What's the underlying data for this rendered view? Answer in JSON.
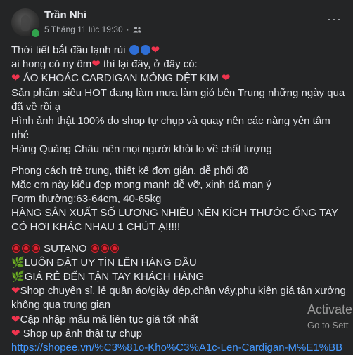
{
  "post": {
    "author": "Trần Nhi",
    "timestamp": "5 Tháng 11 lúc 19:30",
    "separator": "·",
    "more_label": "···",
    "lines": [
      "Thời tiết bắt đầu lạnh rùi",
      "ai hong có ny ôm",
      "thì lại đây, ở đây có:",
      "ÁO KHOÁC CARDIGAN MỎNG DỆT KIM",
      "Sản phẩm siêu HOT đang làm mưa làm gió bên Trung những ngày qua đã về rồi ạ",
      "Hình ảnh thật 100% do shop tự chụp và quay nên các nàng yên tâm nhé",
      "Hàng Quảng Châu nên mọi người khỏi lo về chất lượng",
      "Phong cách trẻ trung, thiết kế đơn giản, dễ phối đồ",
      "Mặc em này kiểu đẹp mong manh dễ vỡ, xinh dã man ý",
      "Form thường:63-64cm, 40-65kg",
      "HÀNG SẢN XUẤT SỐ LƯỢNG NHIỀU NÊN KÍCH THƯỚC ỐNG TAY CÓ HƠI KHÁC NHAU 1 CHÚT Ạ!!!!!",
      "SUTANO",
      "LUÔN ĐẶT UY TÍN  LÊN HÀNG ĐẦU",
      "GIÁ RẺ ĐẾN TẬN TAY KHÁCH HÀNG",
      "Shop chuyên sỉ, lẻ quần áo/giày dép,chân váy,phụ kiện giá tận xưởng không qua trung gian",
      "Cập nhập mẫu mã liên tục giá tốt nhất",
      " Shop up ảnh thật tự chụp"
    ],
    "link": "https://shopee.vn/%C3%81o-Kho%C3%A1c-Len-Cardigan-M%E1%BB"
  },
  "overlay": {
    "activate_title": "Activate",
    "activate_sub": "Go to Sett"
  },
  "icons": {
    "heart": "❤",
    "leaf": "🌿"
  },
  "colors": {
    "background": "#242526",
    "text": "#e4e6eb",
    "muted": "#b0b3b8",
    "link": "#4599ff",
    "heart": "#f0344e",
    "online": "#31a24c"
  }
}
